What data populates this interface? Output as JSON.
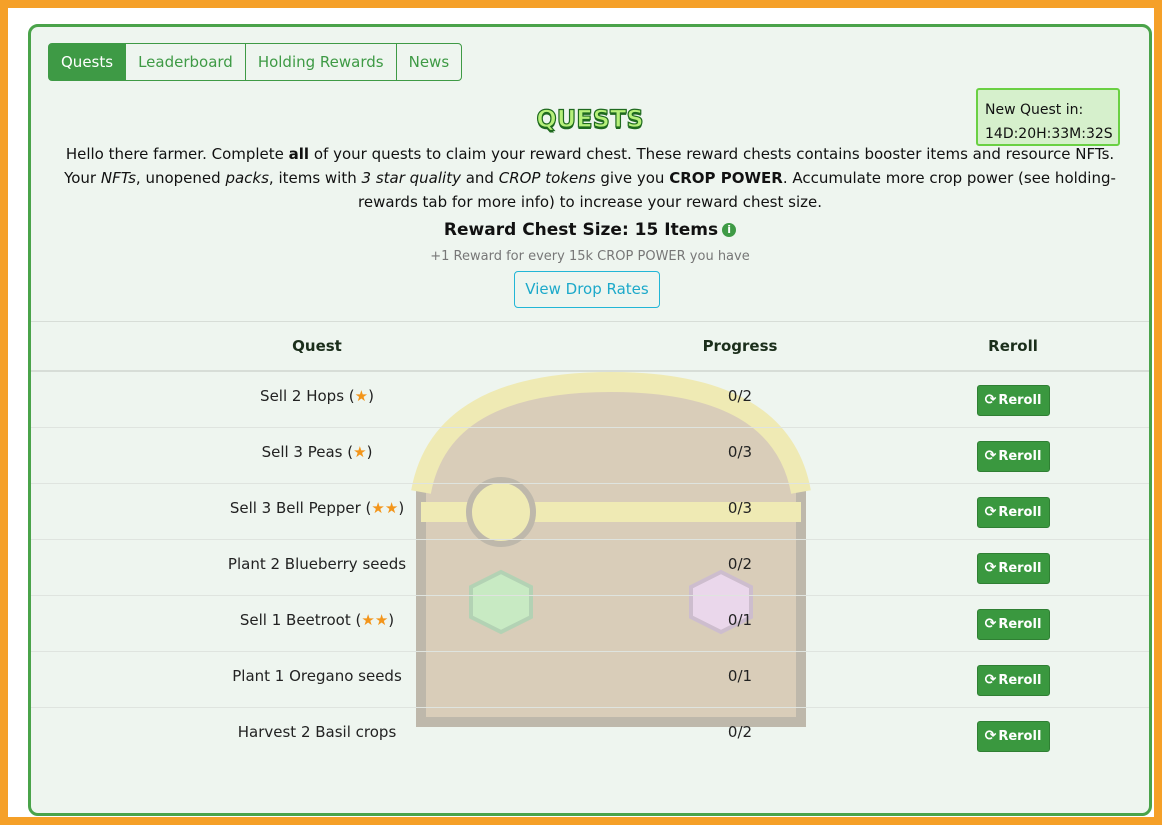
{
  "tabs": [
    "Quests",
    "Leaderboard",
    "Holding Rewards",
    "News"
  ],
  "new_quest": {
    "label": "New Quest in:",
    "countdown": "14D:20H:33M:32S"
  },
  "title": "QUESTS",
  "intro": {
    "p1": "Hello there farmer. Complete ",
    "p1_bold": "all",
    "p2": " of your quests to claim your reward chest. These reward chests contains booster items and resource NFTs. Your ",
    "nfts": "NFTs",
    "p3": ", unopened ",
    "packs": "packs",
    "p4": ", items with ",
    "star_quality": "3 star quality",
    "p5": " and ",
    "crop_tokens": "CROP tokens",
    "p6": " give you ",
    "crop_power": "CROP POWER",
    "p7": ". Accumulate more crop power (see holding-rewards tab for more info) to increase your reward chest size."
  },
  "chest_size": {
    "label": "Reward Chest Size: 15 Items",
    "subtitle": "+1 Reward for every 15k CROP POWER you have"
  },
  "drop_rates_button": "View Drop Rates",
  "table": {
    "headers": {
      "quest": "Quest",
      "progress": "Progress",
      "reroll": "Reroll"
    },
    "reroll_label": "Reroll",
    "rows": [
      {
        "text": "Sell 2 Hops",
        "stars": 1,
        "progress": "0/2"
      },
      {
        "text": "Sell 3 Peas",
        "stars": 1,
        "progress": "0/3"
      },
      {
        "text": "Sell 3 Bell Pepper",
        "stars": 2,
        "progress": "0/3"
      },
      {
        "text": "Plant 2 Blueberry seeds",
        "stars": 0,
        "progress": "0/2"
      },
      {
        "text": "Sell 1 Beetroot",
        "stars": 2,
        "progress": "0/1"
      },
      {
        "text": "Plant 1 Oregano seeds",
        "stars": 0,
        "progress": "0/1"
      },
      {
        "text": "Harvest 2 Basil crops",
        "stars": 0,
        "progress": "0/2"
      }
    ]
  },
  "icons": {
    "info": "info-icon",
    "star": "star-icon",
    "reroll": "refresh-icon"
  },
  "colors": {
    "accent": "#3e9a45",
    "star": "#f3951a",
    "border_outer": "#f5a028",
    "drop_button": "#1ca9ca"
  }
}
